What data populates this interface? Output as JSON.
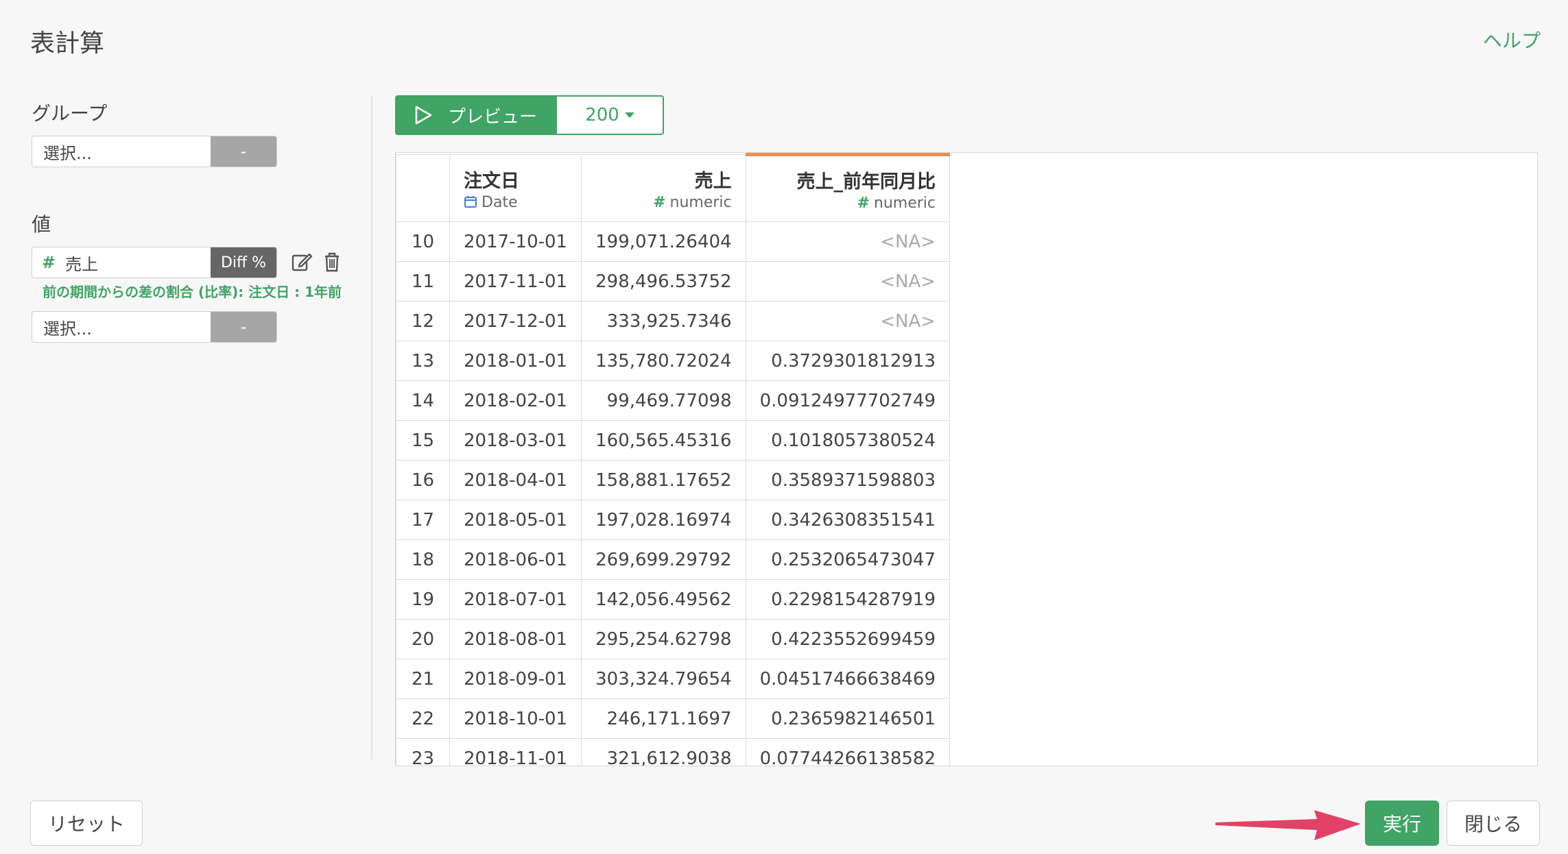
{
  "dialog": {
    "title": "表計算",
    "help": "ヘルプ"
  },
  "group": {
    "label": "グループ",
    "select_placeholder": "選択...",
    "dash": "-"
  },
  "values": {
    "label": "値",
    "item": {
      "hash": "#",
      "name": "売上",
      "op": "Diff %"
    },
    "description": "前の期間からの差の割合 (比率): 注文日 : 1年前",
    "select_placeholder": "選択...",
    "dash": "-"
  },
  "preview": {
    "label": "プレビュー",
    "count": "200"
  },
  "table": {
    "columns": [
      {
        "name": "注文日",
        "type": "Date"
      },
      {
        "name": "売上",
        "type": "numeric"
      },
      {
        "name": "売上_前年同月比",
        "type": "numeric"
      }
    ],
    "rows": [
      {
        "idx": "10",
        "date": "2017-10-01",
        "sales": "199,071.26404",
        "ratio": "<NA>"
      },
      {
        "idx": "11",
        "date": "2017-11-01",
        "sales": "298,496.53752",
        "ratio": "<NA>"
      },
      {
        "idx": "12",
        "date": "2017-12-01",
        "sales": "333,925.7346",
        "ratio": "<NA>"
      },
      {
        "idx": "13",
        "date": "2018-01-01",
        "sales": "135,780.72024",
        "ratio": "0.3729301812913"
      },
      {
        "idx": "14",
        "date": "2018-02-01",
        "sales": "99,469.77098",
        "ratio": "0.09124977702749"
      },
      {
        "idx": "15",
        "date": "2018-03-01",
        "sales": "160,565.45316",
        "ratio": "0.1018057380524"
      },
      {
        "idx": "16",
        "date": "2018-04-01",
        "sales": "158,881.17652",
        "ratio": "0.3589371598803"
      },
      {
        "idx": "17",
        "date": "2018-05-01",
        "sales": "197,028.16974",
        "ratio": "0.3426308351541"
      },
      {
        "idx": "18",
        "date": "2018-06-01",
        "sales": "269,699.29792",
        "ratio": "0.2532065473047"
      },
      {
        "idx": "19",
        "date": "2018-07-01",
        "sales": "142,056.49562",
        "ratio": "0.2298154287919"
      },
      {
        "idx": "20",
        "date": "2018-08-01",
        "sales": "295,254.62798",
        "ratio": "0.4223552699459"
      },
      {
        "idx": "21",
        "date": "2018-09-01",
        "sales": "303,324.79654",
        "ratio": "0.04517466638469"
      },
      {
        "idx": "22",
        "date": "2018-10-01",
        "sales": "246,171.1697",
        "ratio": "0.2365982146501"
      },
      {
        "idx": "23",
        "date": "2018-11-01",
        "sales": "321,612.9038",
        "ratio": "0.07744266138582"
      }
    ]
  },
  "footer": {
    "reset": "リセット",
    "run": "実行",
    "close": "閉じる"
  },
  "colors": {
    "accent": "#3fa465",
    "selected_column": "#e99050",
    "arrow": "#e04365"
  }
}
